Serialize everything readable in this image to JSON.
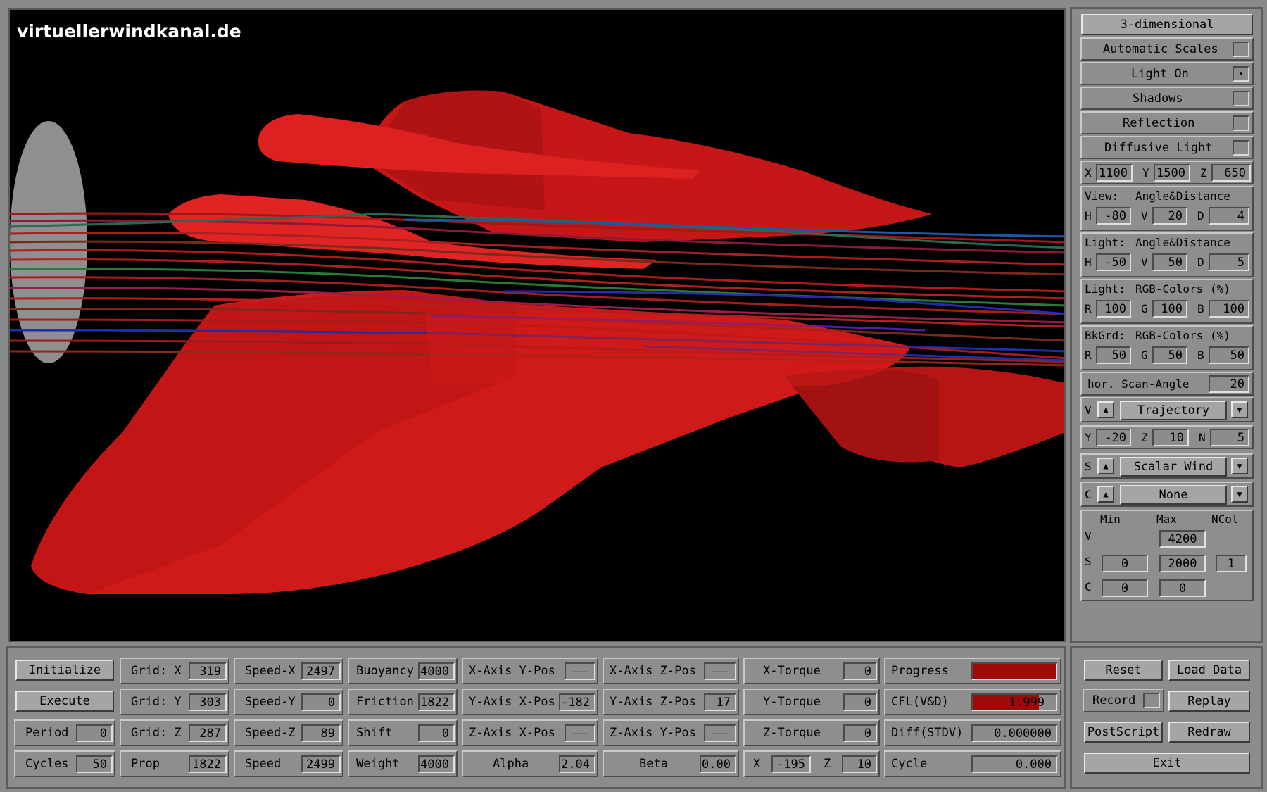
{
  "watermark": "virtuellerwindkanal.de",
  "right_panel": {
    "mode_button": "3-dimensional",
    "toggles": [
      {
        "label": "Automatic Scales",
        "checked": ""
      },
      {
        "label": "Light On",
        "checked": "•"
      },
      {
        "label": "Shadows",
        "checked": ""
      },
      {
        "label": "Reflection",
        "checked": ""
      },
      {
        "label": "Diffusive Light",
        "checked": ""
      }
    ],
    "pos": {
      "x_label": "X",
      "x": "1100",
      "y_label": "Y",
      "y": "1500",
      "z_label": "Z",
      "z": "650"
    },
    "view": {
      "title_a": "View:",
      "title_b": "Angle&Distance",
      "h_label": "H",
      "h": "-80",
      "v_label": "V",
      "v": "20",
      "d_label": "D",
      "d": "4"
    },
    "light_angle": {
      "title_a": "Light:",
      "title_b": "Angle&Distance",
      "h_label": "H",
      "h": "-50",
      "v_label": "V",
      "v": "50",
      "d_label": "D",
      "d": "5"
    },
    "light_rgb": {
      "title_a": "Light:",
      "title_b": "RGB-Colors (%)",
      "r_label": "R",
      "r": "100",
      "g_label": "G",
      "g": "100",
      "b_label": "B",
      "b": "100"
    },
    "bkgrd_rgb": {
      "title_a": "BkGrd:",
      "title_b": "RGB-Colors (%)",
      "r_label": "R",
      "r": "50",
      "g_label": "G",
      "g": "50",
      "b_label": "B",
      "b": "50"
    },
    "scan_angle": {
      "label": "hor. Scan-Angle",
      "value": "20"
    },
    "v_select": {
      "prefix": "V",
      "up": "▲",
      "value": "Trajectory",
      "down": "▼"
    },
    "traj": {
      "y_label": "Y",
      "y": "-20",
      "z_label": "Z",
      "z": "10",
      "n_label": "N",
      "n": "5"
    },
    "s_select": {
      "prefix": "S",
      "up": "▲",
      "value": "Scalar Wind",
      "down": "▼"
    },
    "c_select": {
      "prefix": "C",
      "up": "▲",
      "value": "None",
      "down": "▼"
    },
    "scales": {
      "min_h": "Min",
      "max_h": "Max",
      "ncol_h": "NCol",
      "v_label": "V",
      "v_max": "4200",
      "s_label": "S",
      "s_min": "0",
      "s_max": "2000",
      "s_ncol": "1",
      "c_label": "C",
      "c_min": "0",
      "c_max": "0"
    }
  },
  "bottom": {
    "initialize": "Initialize",
    "execute": "Execute",
    "period": {
      "label": "Period",
      "value": "0"
    },
    "cycles": {
      "label": "Cycles",
      "value": "50"
    },
    "grid_x": {
      "label": "Grid: X",
      "value": "319"
    },
    "grid_y": {
      "label": "Grid: Y",
      "value": "303"
    },
    "grid_z": {
      "label": "Grid: Z",
      "value": "287"
    },
    "prop": {
      "label": "Prop",
      "value": "1822"
    },
    "speed_x": {
      "label": "Speed-X",
      "value": "2497"
    },
    "speed_y": {
      "label": "Speed-Y",
      "value": "0"
    },
    "speed_z": {
      "label": "Speed-Z",
      "value": "89"
    },
    "speed": {
      "label": "Speed",
      "value": "2499"
    },
    "buoyancy": {
      "label": "Buoyancy",
      "value": "4000"
    },
    "friction": {
      "label": "Friction",
      "value": "1822"
    },
    "shift": {
      "label": "Shift",
      "value": "0"
    },
    "weight": {
      "label": "Weight",
      "value": "4000"
    },
    "xaxis_ypos": {
      "label": "X-Axis Y-Pos",
      "value": "——"
    },
    "yaxis_xpos": {
      "label": "Y-Axis X-Pos",
      "value": "-182"
    },
    "zaxis_xpos": {
      "label": "Z-Axis X-Pos",
      "value": "——"
    },
    "alpha": {
      "label": "Alpha",
      "value": "2.04"
    },
    "xaxis_zpos": {
      "label": "X-Axis Z-Pos",
      "value": "——"
    },
    "yaxis_zpos": {
      "label": "Y-Axis Z-Pos",
      "value": "17"
    },
    "zaxis_ypos": {
      "label": "Z-Axis Y-Pos",
      "value": "——"
    },
    "beta": {
      "label": "Beta",
      "value": "0.00"
    },
    "x_torque": {
      "label": "X-Torque",
      "value": "0"
    },
    "y_torque": {
      "label": "Y-Torque",
      "value": "0"
    },
    "z_torque": {
      "label": "Z-Torque",
      "value": "0"
    },
    "xz": {
      "x_label": "X",
      "x": "-195",
      "z_label": "Z",
      "z": "10"
    },
    "progress": {
      "label": "Progress",
      "fill": 1.0
    },
    "cfl": {
      "label": "CFL(V&D)",
      "value": "1.999",
      "fill": 0.8
    },
    "diff": {
      "label": "Diff(STDV)",
      "value": "0.000000"
    },
    "cycle": {
      "label": "Cycle",
      "value": "0.000"
    }
  },
  "actions": {
    "reset": "Reset",
    "load_data": "Load Data",
    "record": "Record",
    "replay": "Replay",
    "postscript": "PostScript",
    "redraw": "Redraw",
    "exit": "Exit"
  },
  "colors": {
    "shape": "#d01818",
    "background": "#000000",
    "panel": "#8c8c8c"
  }
}
